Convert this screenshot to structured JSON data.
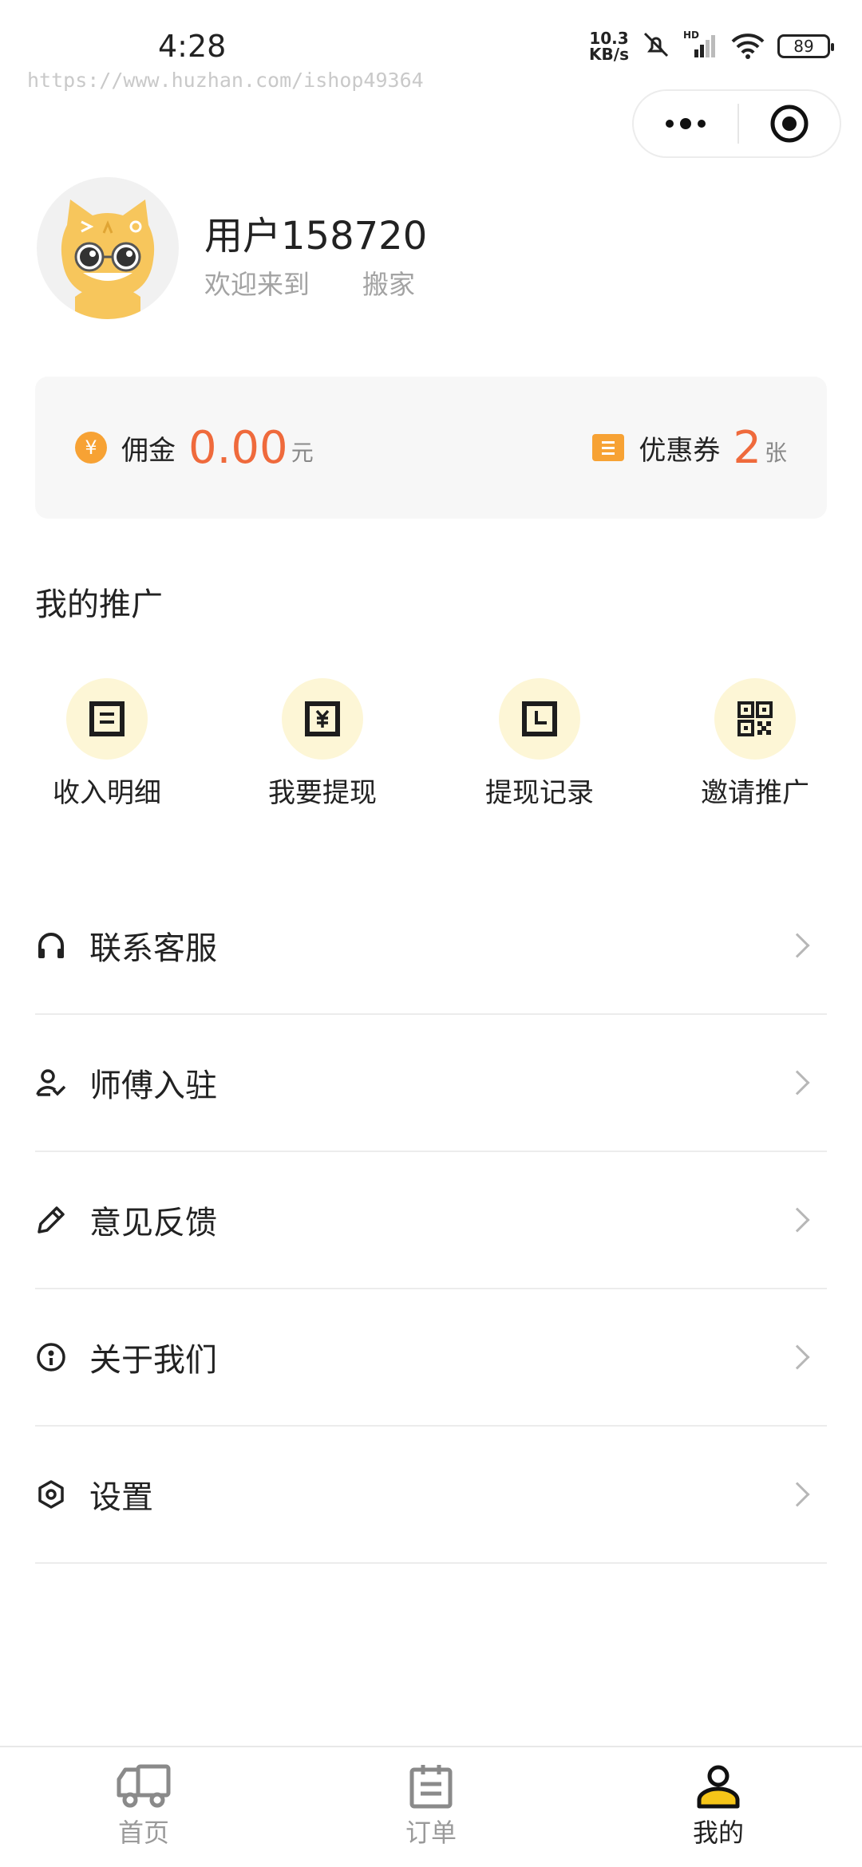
{
  "status_bar": {
    "time": "4:28",
    "net_speed_value": "10.3",
    "net_speed_unit": "KB/s",
    "signal_label": "HD",
    "battery": "89"
  },
  "watermark": "https://www.huzhan.com/ishop49364",
  "profile": {
    "username": "用户158720",
    "welcome": "欢迎来到　　搬家"
  },
  "wallet": {
    "commission_label": "佣金",
    "commission_value": "0.00",
    "commission_unit": "元",
    "coupon_label": "优惠券",
    "coupon_value": "2",
    "coupon_unit": "张",
    "accent_color": "#ef6a3c",
    "icon_color": "#f7a234"
  },
  "promotion": {
    "title": "我的推广",
    "items": [
      {
        "label": "收入明细",
        "icon": "income-detail-icon"
      },
      {
        "label": "我要提现",
        "icon": "withdraw-icon"
      },
      {
        "label": "提现记录",
        "icon": "withdraw-record-icon"
      },
      {
        "label": "邀请推广",
        "icon": "qrcode-icon"
      }
    ]
  },
  "menu": {
    "items": [
      {
        "label": "联系客服",
        "icon": "headset-icon"
      },
      {
        "label": "师傅入驻",
        "icon": "user-check-icon"
      },
      {
        "label": "意见反馈",
        "icon": "pencil-icon"
      },
      {
        "label": "关于我们",
        "icon": "info-circle-icon"
      },
      {
        "label": "设置",
        "icon": "hexagon-settings-icon"
      }
    ]
  },
  "tabbar": {
    "items": [
      {
        "label": "首页",
        "icon": "truck-icon",
        "active": false
      },
      {
        "label": "订单",
        "icon": "order-icon",
        "active": false
      },
      {
        "label": "我的",
        "icon": "profile-icon",
        "active": true
      }
    ],
    "active_color": "#f5c518"
  }
}
